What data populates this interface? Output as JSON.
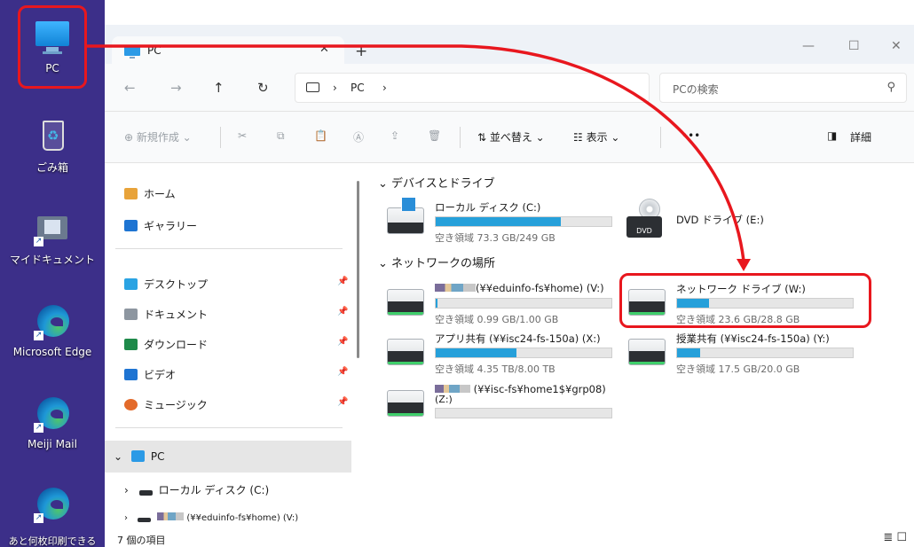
{
  "desktop": {
    "icons": [
      {
        "label": "PC",
        "icon": "pc-icon"
      },
      {
        "label": "ごみ箱",
        "icon": "recycle-bin-icon"
      },
      {
        "label": "マイドキュメント",
        "icon": "folder-icon"
      },
      {
        "label": "Microsoft Edge",
        "icon": "edge-icon"
      },
      {
        "label": "Meiji Mail",
        "icon": "edge-icon"
      }
    ],
    "bottom_label": "あと何枚印刷できる"
  },
  "window": {
    "tab_title": "PC",
    "tab_close": "✕",
    "new_tab": "+",
    "controls": {
      "minimize": "—",
      "maximize": "☐",
      "close": "✕"
    }
  },
  "address": {
    "back": "←",
    "forward": "→",
    "up": "↑",
    "refresh": "↻",
    "separator": "›",
    "crumb": "PC",
    "search_placeholder": "PCの検索",
    "search_icon": "⚲"
  },
  "toolbar": {
    "new_label": "⊕ 新規作成 ⌄",
    "cut": "✂",
    "copy": "⧉",
    "paste": "📋",
    "rename": "Ⓐ",
    "share": "⇪",
    "delete": "🗑",
    "sort_label": "⇅ 並べ替え ⌄",
    "view_label": "☷ 表示 ⌄",
    "more": "•••",
    "details_label": "詳細"
  },
  "navpane": {
    "quick": [
      {
        "label": "ホーム",
        "color": "#e8a33a"
      },
      {
        "label": "ギャラリー",
        "color": "#1e74d2"
      }
    ],
    "pinned": [
      {
        "label": "デスクトップ",
        "color": "#2aa3e3"
      },
      {
        "label": "ドキュメント",
        "color": "#8d96a0"
      },
      {
        "label": "ダウンロード",
        "color": "#1e8a4a"
      },
      {
        "label": "ビデオ",
        "color": "#1e74d2"
      },
      {
        "label": "ミュージック",
        "color": "#e36a2a"
      }
    ],
    "pin_glyph": "📌",
    "tree": [
      {
        "label": "PC",
        "chevron": "⌄"
      },
      {
        "label": "ローカル ディスク (C:)",
        "chevron": "›"
      },
      {
        "label": "(¥¥eduinfo-fs¥home) (V:)",
        "chevron": "›"
      }
    ]
  },
  "content": {
    "section1": "デバイスとドライブ",
    "section2": "ネットワークの場所",
    "drives": [
      {
        "name": "ローカル ディスク (C:)",
        "free": "空き領域 73.3 GB/249 GB",
        "used_fraction": 0.71
      },
      {
        "name": "DVD ドライブ (E:)",
        "free": "",
        "used_fraction": null
      }
    ],
    "network": [
      {
        "name": "(¥¥eduinfo-fs¥home) (V:)",
        "free": "空き領域 0.99 GB/1.00 GB",
        "used_fraction": 0.01
      },
      {
        "name": "ネットワーク ドライブ (W:)",
        "free": "空き領域 23.6 GB/28.8 GB",
        "used_fraction": 0.18
      },
      {
        "name": "アプリ共有 (¥¥isc24-fs-150a) (X:)",
        "free": "空き領域 4.35 TB/8.00 TB",
        "used_fraction": 0.46
      },
      {
        "name": "授業共有 (¥¥isc24-fs-150a) (Y:)",
        "free": "空き領域 17.5 GB/20.0 GB",
        "used_fraction": 0.13
      },
      {
        "name": "(¥¥isc-fs¥home1$¥grp08)",
        "name2": "(Z:)",
        "free": "",
        "used_fraction": 0
      }
    ],
    "dvd_label": "DVD"
  },
  "status": {
    "items_label": "7 個の項目",
    "icons": "≣ ☐"
  },
  "accent": {
    "annotation": "#e8171e",
    "bar": "#26a0da",
    "wallpaper": "#3c2f89"
  }
}
